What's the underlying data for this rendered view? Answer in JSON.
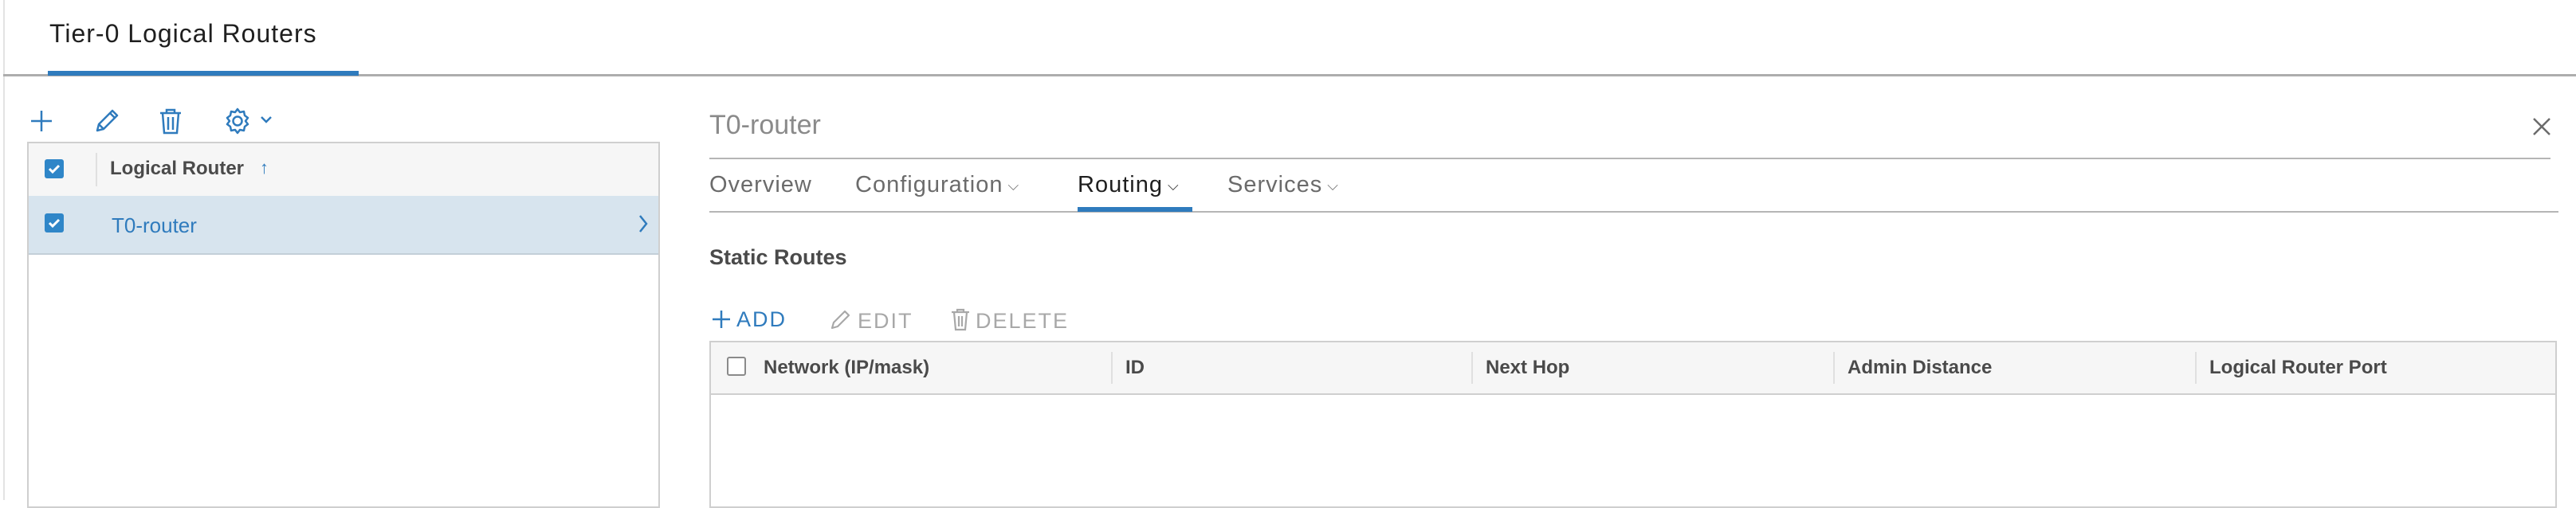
{
  "header": {
    "title": "Tier-0 Logical Routers"
  },
  "toolbar": {
    "icons": [
      "add-icon",
      "edit-icon",
      "delete-icon",
      "settings-icon",
      "chevron-down-icon"
    ]
  },
  "router_list": {
    "column_header": "Logical Router",
    "sort_indicator": "↑",
    "header_checked": true,
    "rows": [
      {
        "label": "T0-router",
        "checked": true,
        "selected": true
      }
    ]
  },
  "detail": {
    "title": "T0-router",
    "tabs": [
      {
        "label": "Overview",
        "has_dropdown": false,
        "active": false
      },
      {
        "label": "Configuration",
        "has_dropdown": true,
        "active": false
      },
      {
        "label": "Routing",
        "has_dropdown": true,
        "active": true
      },
      {
        "label": "Services",
        "has_dropdown": true,
        "active": false
      }
    ],
    "section_title": "Static Routes",
    "actions": {
      "add": "ADD",
      "edit": "EDIT",
      "delete": "DELETE"
    },
    "table": {
      "columns": [
        "Network (IP/mask)",
        "ID",
        "Next Hop",
        "Admin Distance",
        "Logical Router Port"
      ],
      "rows": []
    }
  },
  "colors": {
    "accent": "#2f7bbd",
    "selected_row": "#d7e4ee",
    "header_bg": "#f6f6f6"
  }
}
